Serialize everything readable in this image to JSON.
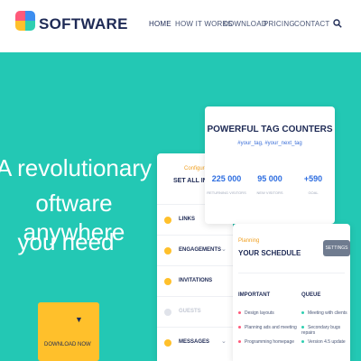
{
  "header": {
    "brand": "SOFTWARE",
    "logo_colors": [
      "#ff5a7a",
      "#3c8ef0",
      "#ffc02b",
      "#2fcfb1"
    ],
    "nav": [
      "HOME",
      "HOW IT WORKS",
      "DOWNLOAD",
      "PRICING",
      "CONTACT"
    ],
    "active_nav": "HOME"
  },
  "hero": {
    "lines": [
      "A revolutionary",
      "oftware anywhere",
      "you need"
    ],
    "download_label": "DOWNLOAD NOW"
  },
  "menu_card": {
    "configure": "Configure",
    "title": "SET ALL IN ONE",
    "items": [
      {
        "label": "LINKS",
        "dot": "#ffc02b"
      },
      {
        "label": "ENGAGEMENTS",
        "dot": "#ffc02b"
      },
      {
        "label": "INVITATIONS",
        "dot": "#ffc02b"
      },
      {
        "label": "GUESTS",
        "dot": "#e0e3ea"
      },
      {
        "label": "MESSAGES",
        "dot": "#ffc02b"
      }
    ]
  },
  "counters_card": {
    "title": "POWERFUL TAG COUNTERS",
    "tags": "#your_tag, #your_next_tag",
    "stats": [
      {
        "value": "225 000",
        "caption": "RETURNING VISITORS"
      },
      {
        "value": "95 000",
        "caption": "NEW VISITORS"
      },
      {
        "value": "+590",
        "caption": "GOAL"
      }
    ]
  },
  "schedule_card": {
    "kicker": "Planning",
    "title": "YOUR SCHEDULE",
    "settings_label": "SETTINGS",
    "columns": [
      {
        "header": "IMPORTANT",
        "tasks": [
          "Design layouts",
          "Planning ads and meeting",
          "Programming homepage"
        ],
        "bullet": "#ff5a7a"
      },
      {
        "header": "QUEUE",
        "tasks": [
          "Meeting with clients",
          "Secondary bugs repairs",
          "Version 4.5 update"
        ],
        "bullet": "#2fcfb1"
      }
    ]
  }
}
